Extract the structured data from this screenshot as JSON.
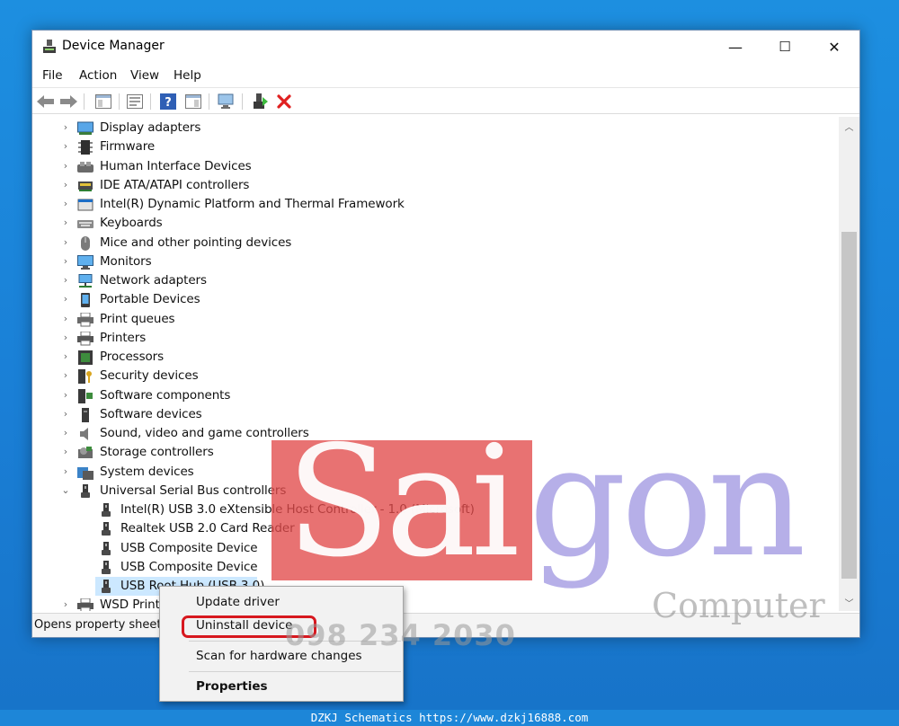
{
  "window": {
    "title": "Device Manager",
    "minimize": "—",
    "maximize": "☐",
    "close": "✕"
  },
  "menu": [
    "File",
    "Action",
    "View",
    "Help"
  ],
  "tree": {
    "categories": [
      {
        "label": "Display adapters",
        "icon": "display-adapter-icon"
      },
      {
        "label": "Firmware",
        "icon": "firmware-icon"
      },
      {
        "label": "Human Interface Devices",
        "icon": "hid-icon"
      },
      {
        "label": "IDE ATA/ATAPI controllers",
        "icon": "ide-controller-icon"
      },
      {
        "label": "Intel(R) Dynamic Platform and Thermal Framework",
        "icon": "thermal-framework-icon"
      },
      {
        "label": "Keyboards",
        "icon": "keyboard-icon"
      },
      {
        "label": "Mice and other pointing devices",
        "icon": "mouse-icon"
      },
      {
        "label": "Monitors",
        "icon": "monitor-icon"
      },
      {
        "label": "Network adapters",
        "icon": "network-adapter-icon"
      },
      {
        "label": "Portable Devices",
        "icon": "portable-device-icon"
      },
      {
        "label": "Print queues",
        "icon": "print-queue-icon"
      },
      {
        "label": "Printers",
        "icon": "printer-icon"
      },
      {
        "label": "Processors",
        "icon": "processor-icon"
      },
      {
        "label": "Security devices",
        "icon": "security-device-icon"
      },
      {
        "label": "Software components",
        "icon": "software-component-icon"
      },
      {
        "label": "Software devices",
        "icon": "software-device-icon"
      },
      {
        "label": "Sound, video and game controllers",
        "icon": "sound-icon"
      },
      {
        "label": "Storage controllers",
        "icon": "storage-controller-icon"
      },
      {
        "label": "System devices",
        "icon": "system-device-icon"
      }
    ],
    "usb_category": "Universal Serial Bus controllers",
    "usb_children": [
      "Intel(R) USB 3.0 eXtensible Host Controller - 1.0 (Microsoft)",
      "Realtek USB 2.0 Card Reader",
      "USB Composite Device",
      "USB Composite Device",
      "USB Root Hub (USB 3.0)"
    ],
    "last_category": "WSD Print Provider"
  },
  "status": "Opens property sheet for the current selection.",
  "context_menu": {
    "update": "Update driver",
    "uninstall": "Uninstall device",
    "scan": "Scan for hardware changes",
    "properties": "Properties"
  },
  "watermark": {
    "sai": "Sai",
    "gon": "gon",
    "computer": "Computer",
    "phone": "098 234 2030"
  },
  "footer": "DZKJ Schematics https://www.dzkj16888.com",
  "colors": {
    "selection": "#cce8ff",
    "highlight_ring": "#d7181f",
    "delete_red": "#e02020"
  }
}
